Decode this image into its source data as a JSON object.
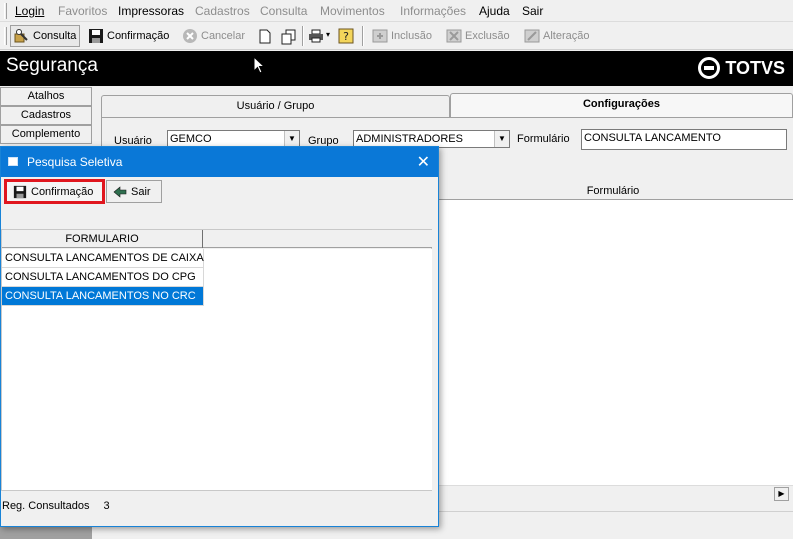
{
  "menubar": {
    "items": [
      {
        "label": "Login",
        "enabled": true
      },
      {
        "label": "Favoritos",
        "enabled": false
      },
      {
        "label": "Impressoras",
        "enabled": true
      },
      {
        "label": "Cadastros",
        "enabled": false
      },
      {
        "label": "Consulta",
        "enabled": false
      },
      {
        "label": "Movimentos",
        "enabled": false
      },
      {
        "label": "Informações",
        "enabled": false
      },
      {
        "label": "Ajuda",
        "enabled": true
      },
      {
        "label": "Sair",
        "enabled": true
      }
    ]
  },
  "toolbar": {
    "consulta_label": "Consulta",
    "confirmacao_label": "Confirmação",
    "cancelar_label": "Cancelar",
    "inclusao_label": "Inclusão",
    "exclusao_label": "Exclusão",
    "alteracao_label": "Alteração"
  },
  "app": {
    "title": "Segurança",
    "logo_text": "TOTVS"
  },
  "sidebar": {
    "items": [
      {
        "label": "Atalhos"
      },
      {
        "label": "Cadastros"
      },
      {
        "label": "Complemento"
      }
    ]
  },
  "main": {
    "tabs": [
      {
        "label": "Usuário  / Grupo",
        "active": false
      },
      {
        "label": "Configurações",
        "active": true
      }
    ],
    "usuario_label": "Usuário",
    "usuario_value": "GEMCO",
    "grupo_label": "Grupo",
    "grupo_value": "ADMINISTRADORES",
    "formulario_label": "Formulário",
    "formulario_value": "CONSULTA LANCAMENTO",
    "grid_header": "Formulário"
  },
  "dialog": {
    "title": "Pesquisa Seletiva",
    "close_glyph": "✕",
    "confirm_label": "Confirmação",
    "sair_label": "Sair",
    "column_header": "FORMULARIO",
    "rows": [
      {
        "text": "CONSULTA LANCAMENTOS DE CAIXA",
        "selected": false
      },
      {
        "text": "CONSULTA LANCAMENTOS DO CPG",
        "selected": false
      },
      {
        "text": "CONSULTA LANCAMENTOS NO CRC",
        "selected": true
      }
    ],
    "status_label": "Reg. Consultados",
    "status_count": "3"
  },
  "colors": {
    "dialog_titlebar": "#0a78d7",
    "selection": "#0078d7",
    "highlight_border": "#e0161e",
    "app_titlebar": "#000000"
  }
}
